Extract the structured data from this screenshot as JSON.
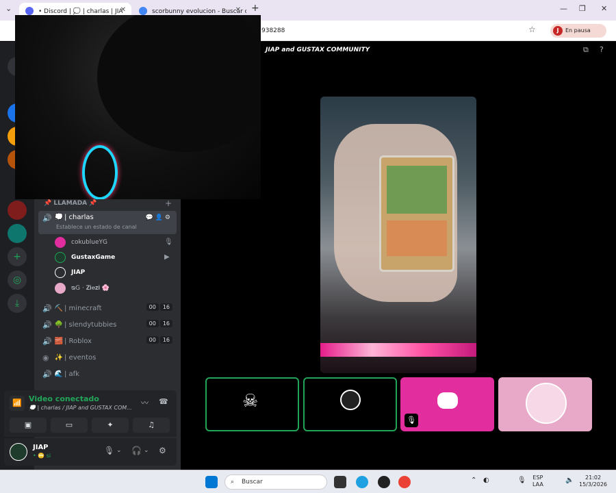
{
  "browser": {
    "tabs": [
      {
        "label": "• Discord | 💭 | charlas | JIA"
      },
      {
        "label": "scorbunny evolucion - Buscar c"
      }
    ],
    "new_tab": "+",
    "address": "938288",
    "profile_initial": "J",
    "profile_label": "En pausa"
  },
  "discord": {
    "server_name": "JIAP and GUSTAX COMMUNITY",
    "category": "📌 LLAMADA 📌",
    "selected_channel": {
      "emoji": "💭",
      "name": "| charlas",
      "status": "Establece un estado de canal"
    },
    "voice_users": [
      {
        "name": "cokublueYG"
      },
      {
        "name": "GustaxGame"
      },
      {
        "name": "JIAP"
      },
      {
        "name": "ᴓG · 𝐙𝐢𝐞𝐳𝐢 🌸"
      }
    ],
    "channels": [
      {
        "emoji": "⛏️",
        "name": "| minecraft",
        "count": "00",
        "limit": "16"
      },
      {
        "emoji": "🌳",
        "name": "| slendytubbies",
        "count": "00",
        "limit": "16"
      },
      {
        "emoji": "🧱",
        "name": "| Roblox",
        "count": "00",
        "limit": "16"
      },
      {
        "emoji": "✨",
        "name": "| eventos"
      },
      {
        "emoji": "🌊",
        "name": "| afk"
      }
    ],
    "voice_panel": {
      "title": "Video conectado",
      "subtitle": "💭 | charlas / JIAP and GUSTAX COM..."
    },
    "user": {
      "name": "JIAP",
      "status": "• 🙄 si"
    }
  },
  "taskbar": {
    "search_placeholder": "Buscar",
    "lang1": "ESP",
    "lang2": "LAA",
    "time": "21:02",
    "date": "15/3/2026"
  },
  "colors": {
    "discord_green": "#23a559",
    "discord_pink": "#e12d9e",
    "tile_pink_light": "#e8a8c8"
  }
}
